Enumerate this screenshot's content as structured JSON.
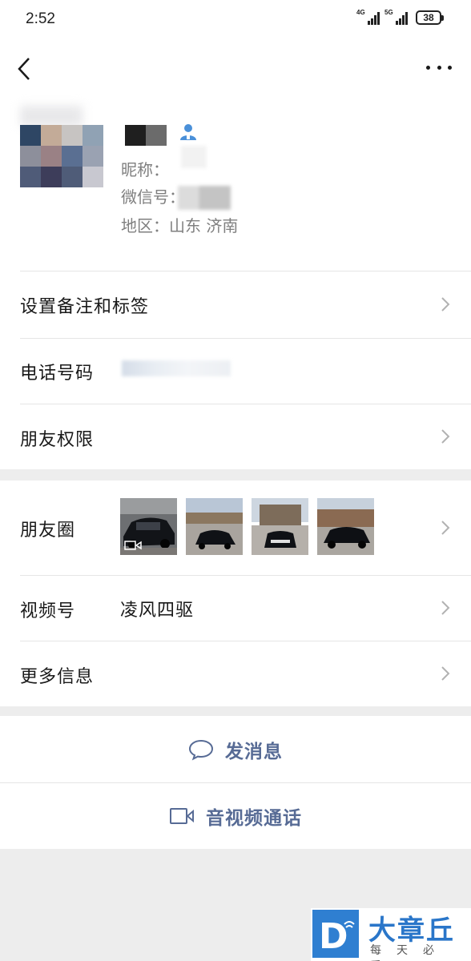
{
  "status_bar": {
    "time": "2:52",
    "network_1": "4G",
    "network_2": "5G",
    "battery": "38"
  },
  "profile": {
    "nickname_label": "昵称：",
    "wechat_id_label": "微信号：",
    "region_label": "地区：",
    "region_value": "山东  济南",
    "contact_icon": "person-icon"
  },
  "menu": {
    "remark_label": "设置备注和标签",
    "phone_label": "电话号码",
    "permissions_label": "朋友权限",
    "moments_label": "朋友圈",
    "channels_label": "视频号",
    "channels_value": "凌风四驱",
    "more_info_label": "更多信息"
  },
  "actions": {
    "message_label": "发消息",
    "call_label": "音视频通话"
  },
  "watermark": {
    "title": "大章丘",
    "subtitle": "每天必看",
    "badge": "D"
  },
  "colors": {
    "link": "#576b95",
    "background": "#ededed",
    "brand": "#2f7fd1"
  }
}
